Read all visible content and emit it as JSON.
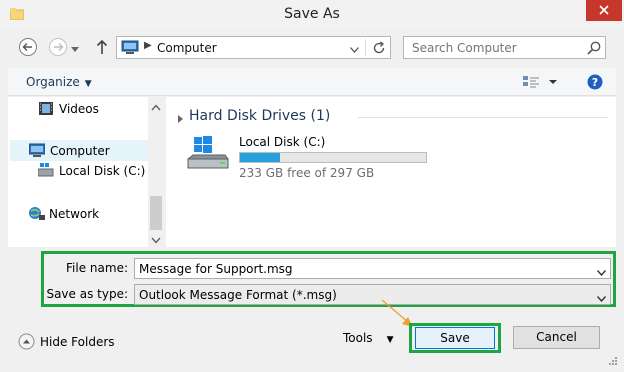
{
  "window": {
    "title": "Save As"
  },
  "address": {
    "location": "Computer"
  },
  "search": {
    "placeholder": "Search Computer"
  },
  "toolbar": {
    "organize_label": "Organize"
  },
  "nav": {
    "items": [
      {
        "label": "Videos",
        "icon": "videos-icon"
      },
      {
        "label": "Computer",
        "icon": "computer-icon"
      },
      {
        "label": "Local Disk (C:)",
        "icon": "drive-icon"
      },
      {
        "label": "Network",
        "icon": "network-icon"
      }
    ]
  },
  "content": {
    "group_header": "Hard Disk Drives (1)",
    "drive": {
      "name": "Local Disk (C:)",
      "free_text": "233 GB free of 297 GB",
      "used_fraction": 0.215
    }
  },
  "form": {
    "filename_label": "File name:",
    "filename_value": "Message for Support.msg",
    "type_label": "Save as type:",
    "type_value": "Outlook Message Format (*.msg)"
  },
  "footer": {
    "hide_folders_label": "Hide Folders",
    "tools_label": "Tools",
    "save_label": "Save",
    "cancel_label": "Cancel"
  },
  "colors": {
    "highlight": "#1fa540",
    "accent": "#26a0da",
    "close": "#c7372b",
    "arrow": "#f0a030"
  }
}
